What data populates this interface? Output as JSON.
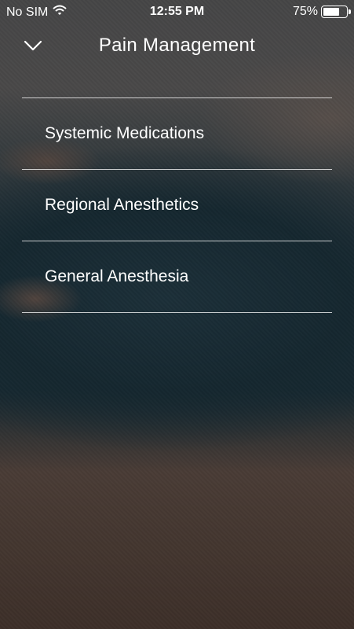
{
  "status_bar": {
    "carrier": "No SIM",
    "time": "12:55 PM",
    "battery_text": "75%",
    "battery_level": 0.75
  },
  "header": {
    "title": "Pain Management",
    "collapse_icon": "chevron-down-icon"
  },
  "menu": {
    "items": [
      {
        "label": "Systemic Medications"
      },
      {
        "label": "Regional Anesthetics"
      },
      {
        "label": "General Anesthesia"
      }
    ]
  },
  "colors": {
    "text": "#ffffff",
    "divider": "#ffffffbf",
    "overlay": "#000000"
  }
}
